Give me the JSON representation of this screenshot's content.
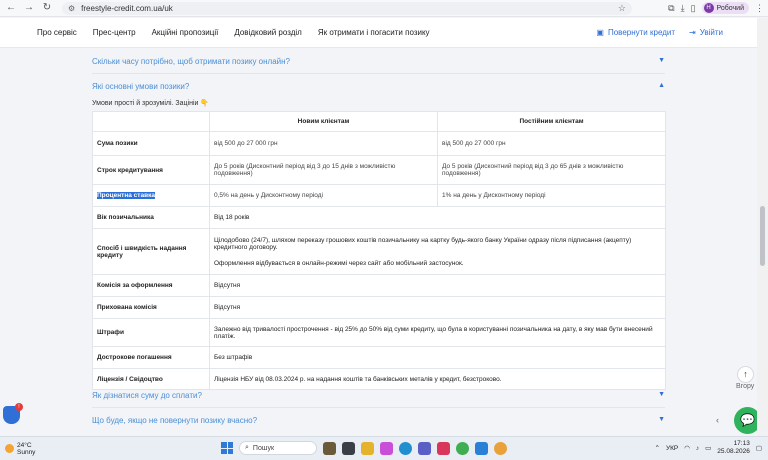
{
  "browser": {
    "url": "freestyle-credit.com.ua/uk",
    "profile_initial": "Н",
    "profile_name": "Робочий"
  },
  "header": {
    "nav": [
      "Про сервіс",
      "Прес-центр",
      "Акційні пропозиції",
      "Довідковий розділ",
      "Як отримати і погасити позику"
    ],
    "return_credit": "Повернути кредит",
    "login": "Увійти"
  },
  "faq": {
    "q_time": "Скільки часу потрібно, щоб отримати позику онлайн?",
    "q_conditions": "Які основні умови позики?",
    "lead": "Умови прості й зрозумілі. Зацініи 👇",
    "q_sum": "Як дізнатися суму до сплати?",
    "q_late": "Що буде, якщо не повернути позику вчасно?"
  },
  "table": {
    "col_new": "Новим клієнтам",
    "col_regular": "Постійним клієнтам",
    "rows": [
      {
        "label": "Сума позики",
        "new": "від 500 до 27 000 грн",
        "regular": "від 500 до 27 000 грн"
      },
      {
        "label": "Строк кредитування",
        "new": "До 5 років (Дисконтний період від 3 до 15 днів з можливістю подовження)",
        "regular": "До 5 років (Дисконтний період від 3 до 65 днів з можливістю подовження)"
      },
      {
        "label": "Процентна ставка",
        "new": "0,5% на день у Дисконтному періоді",
        "regular": "1% на день у Дисконтному періоді"
      },
      {
        "label": "Вік позичальника",
        "both": "Від 18 років"
      },
      {
        "label": "Спосіб і швидкість надання кредиту",
        "both": "Цілодобово (24/7), шляхом переказу грошових коштів позичальнику на картку будь-якого банку України одразу після підписання (акцепту) кредитного договору.",
        "both2": "Оформлення відбувається в онлайн-режимі через сайт або мобільний застосунок."
      },
      {
        "label": "Комісія за оформлення",
        "both": "Відсутня"
      },
      {
        "label": "Прихована комісія",
        "both": "Відсутня"
      },
      {
        "label": "Штрафи",
        "both": "Залежно від тривалості прострочення - від 25% до 50% від суми кредиту, що була в користуванні позичальника на дату, в яку мав бути внесений платіж."
      },
      {
        "label": "Дострокове погашення",
        "both": "Без штрафів"
      },
      {
        "label": "Ліцензія / Свідоцтво",
        "both": "Ліцензія НБУ від 08.03.2024 р. на надання коштів та банківських металів у кредит, безстроково."
      }
    ]
  },
  "floating": {
    "up_label": "Вгору"
  },
  "taskbar": {
    "temp": "24°C",
    "weather": "Sunny",
    "search": "Пошук",
    "lang": "УКР",
    "time": "17:13",
    "date": "25.08.2026"
  }
}
